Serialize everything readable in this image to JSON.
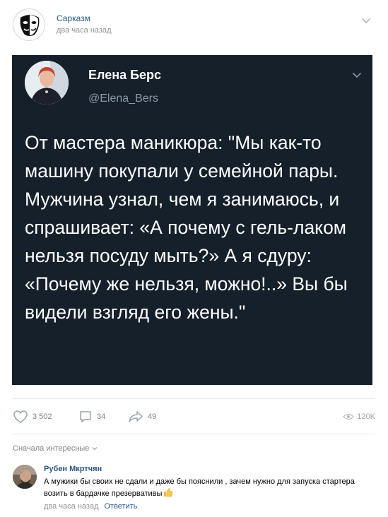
{
  "post": {
    "group_name": "Сарказм",
    "time": "два часа назад"
  },
  "tweet": {
    "author_name": "Елена Берс",
    "author_handle": "@Elena_Bers",
    "text": "От мастера маникюра: \"Мы как-то машину покупали у семейной пары. Мужчина узнал, чем я занимаюсь, и спрашивает: «А почему с гель-лаком нельзя посуду мыть?» А я сдуру: «Почему же нельзя, можно!..» Вы бы видели взгляд его жены.\""
  },
  "actions": {
    "likes": "3 502",
    "comments": "34",
    "shares": "49",
    "views": "120K"
  },
  "comments_sort": "Сначала интересные",
  "comment": {
    "author": "Рубен Мкртчян",
    "text": "А мужики бы своих не сдали и даже бы пояснили , зачем нужно для запуска стартера возить в бардачке презервативы",
    "time": "два часа назад",
    "reply_label": "Ответить"
  },
  "colors": {
    "tweet_background": "#15202b",
    "link": "#2a5885",
    "muted": "#828282"
  },
  "icons": [
    "sarcasm-mask-logo",
    "chevron-down-icon",
    "heart-icon",
    "comment-icon",
    "share-icon",
    "eye-icon",
    "thumbs-up-emoji"
  ]
}
